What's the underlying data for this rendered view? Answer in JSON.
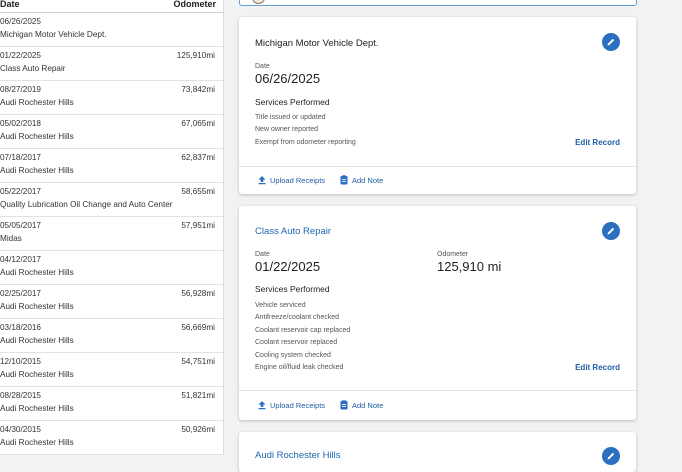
{
  "list": {
    "header_date": "Date",
    "header_odometer": "Odometer",
    "rows": [
      {
        "date": "06/26/2025",
        "source": "Michigan Motor Vehicle Dept.",
        "odometer": ""
      },
      {
        "date": "01/22/2025",
        "source": "Class Auto Repair",
        "odometer": "125,910mi"
      },
      {
        "date": "08/27/2019",
        "source": "Audi Rochester Hills",
        "odometer": "73,842mi"
      },
      {
        "date": "05/02/2018",
        "source": "Audi Rochester Hills",
        "odometer": "67,065mi"
      },
      {
        "date": "07/18/2017",
        "source": "Audi Rochester Hills",
        "odometer": "62,837mi"
      },
      {
        "date": "05/22/2017",
        "source": "Quality Lubrication Oil Change and Auto Center",
        "odometer": "58,655mi"
      },
      {
        "date": "05/05/2017",
        "source": "Midas",
        "odometer": "57,951mi"
      },
      {
        "date": "04/12/2017",
        "source": "Audi Rochester Hills",
        "odometer": ""
      },
      {
        "date": "02/25/2017",
        "source": "Audi Rochester Hills",
        "odometer": "56,928mi"
      },
      {
        "date": "03/18/2016",
        "source": "Audi Rochester Hills",
        "odometer": "56,669mi"
      },
      {
        "date": "12/10/2015",
        "source": "Audi Rochester Hills",
        "odometer": "54,751mi"
      },
      {
        "date": "08/28/2015",
        "source": "Audi Rochester Hills",
        "odometer": "51,821mi"
      },
      {
        "date": "04/30/2015",
        "source": "Audi Rochester Hills",
        "odometer": "50,926mi"
      }
    ]
  },
  "cards": [
    {
      "title": "Michigan Motor Vehicle Dept.",
      "date_label": "Date",
      "date": "06/26/2025",
      "services_label": "Services Performed",
      "services": [
        "Title issued or updated",
        "New owner reported",
        "Exempt from odometer reporting"
      ],
      "edit_label": "Edit Record",
      "upload_label": "Upload Receipts",
      "note_label": "Add Note"
    },
    {
      "title": "Class Auto Repair",
      "date_label": "Date",
      "date": "01/22/2025",
      "odometer_label": "Odometer",
      "odometer": "125,910 mi",
      "services_label": "Services Performed",
      "services": [
        "Vehicle serviced",
        "Antifreeze/coolant checked",
        "Coolant reservoir cap replaced",
        "Coolant reservoir replaced",
        "Cooling system checked",
        "Engine oil/fluid leak checked"
      ],
      "edit_label": "Edit Record",
      "upload_label": "Upload Receipts",
      "note_label": "Add Note"
    },
    {
      "title": "Audi Rochester Hills"
    }
  ],
  "colors": {
    "accent": "#2b6fc0",
    "link": "#1d5ea8",
    "background": "#f1f2f4"
  },
  "icons": [
    "pencil-icon",
    "upload-icon",
    "note-icon",
    "seal-icon"
  ]
}
